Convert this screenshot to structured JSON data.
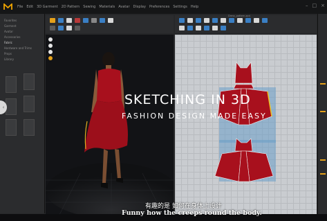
{
  "menubar": {
    "items": [
      "File",
      "Edit",
      "3D Garment",
      "2D Pattern",
      "Sewing",
      "Materials",
      "Avatar",
      "Display",
      "Preferences",
      "Settings",
      "Help"
    ],
    "win_controls": [
      "–",
      "□",
      "×"
    ]
  },
  "left_panel": {
    "tree": [
      "Favorites",
      "Garment",
      "Avatar",
      "Accessories",
      "Fabric",
      "Hardware and Trims",
      "Props",
      "Library"
    ],
    "selected_index": 4,
    "thumb_labels": [
      "",
      "",
      "",
      "",
      "",
      ""
    ]
  },
  "overlay": {
    "title": "SKETCHING IN 3D",
    "subtitle": "FASHION DESIGN MADE EASY"
  },
  "captions": {
    "chinese": "有趣的是 如何在身体上设计",
    "english": "Funny how the creeps round the body."
  },
  "viewport_tabs": {
    "left": "",
    "right": "Dress_pattern.zprj"
  },
  "colors": {
    "dress": "#a8101d",
    "pattern_select": "#6a9ec9",
    "accent": "#f0a500"
  },
  "icons": {
    "logo": "md-logo-icon",
    "handle": "chevron-left-icon"
  }
}
